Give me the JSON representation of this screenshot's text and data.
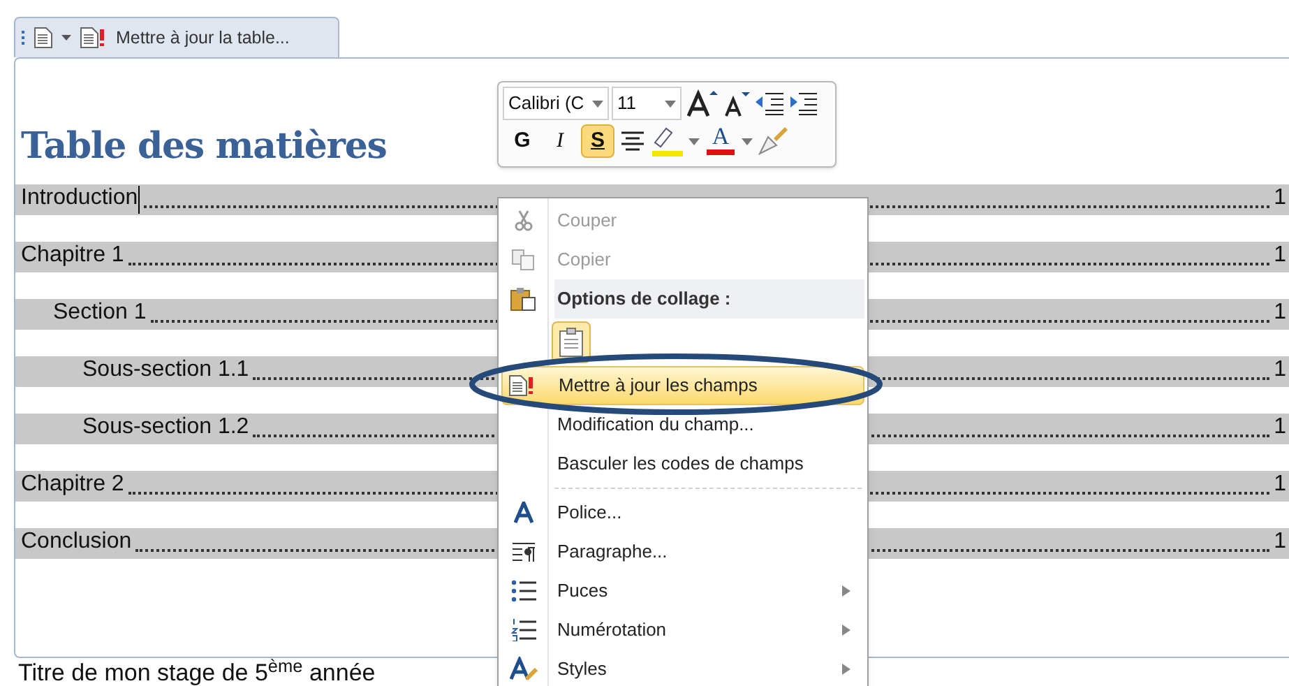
{
  "tab": {
    "label": "Mettre à jour la table..."
  },
  "heading": "Table des matières",
  "toc": [
    {
      "label": "Introduction",
      "page": "1",
      "cursor": true
    },
    {
      "label": "Chapitre 1",
      "page": "1",
      "cursor": false,
      "children": [
        {
          "label": "Section 1",
          "page": "1",
          "cursor": false,
          "children": [
            {
              "label": "Sous-section 1.1",
              "page": "1",
              "cursor": false
            },
            {
              "label": "Sous-section 1.2",
              "page": "1",
              "cursor": false
            }
          ]
        }
      ]
    },
    {
      "label": "Chapitre 2",
      "page": "1",
      "cursor": false
    },
    {
      "label": "Conclusion",
      "page": "1",
      "cursor": false
    }
  ],
  "footer_text": "Titre de mon stage de 5$^{ème}$ année",
  "mini_toolbar": {
    "font": "Calibri (C",
    "size": "11",
    "bold_label": "G",
    "italic_label": "I",
    "strike_label": "S",
    "strike_selected": true,
    "font_color_label": "A"
  },
  "context_menu": [
    {
      "kind": "item",
      "label": "Couper",
      "disabled": true,
      "selected": false,
      "submenu": false
    },
    {
      "kind": "item",
      "label": "Copier",
      "disabled": true,
      "selected": false,
      "submenu": false
    },
    {
      "kind": "header",
      "label": "Options de collage :"
    },
    {
      "kind": "paste"
    },
    {
      "kind": "item",
      "label": "Mettre à jour les champs",
      "disabled": false,
      "selected": true,
      "submenu": false
    },
    {
      "kind": "item",
      "label": "Modification du champ...",
      "disabled": false,
      "selected": false,
      "submenu": false
    },
    {
      "kind": "item",
      "label": "Basculer les codes de champs",
      "disabled": false,
      "selected": false,
      "submenu": false
    },
    {
      "kind": "separator"
    },
    {
      "kind": "item",
      "label": "Police...",
      "disabled": false,
      "selected": false,
      "submenu": false
    },
    {
      "kind": "item",
      "label": "Paragraphe...",
      "disabled": false,
      "selected": false,
      "submenu": false
    },
    {
      "kind": "item",
      "label": "Puces",
      "disabled": false,
      "selected": false,
      "submenu": true
    },
    {
      "kind": "item",
      "label": "Numérotation",
      "disabled": false,
      "selected": false,
      "submenu": true
    },
    {
      "kind": "item",
      "label": "Styles",
      "disabled": false,
      "selected": false,
      "submenu": true
    }
  ]
}
